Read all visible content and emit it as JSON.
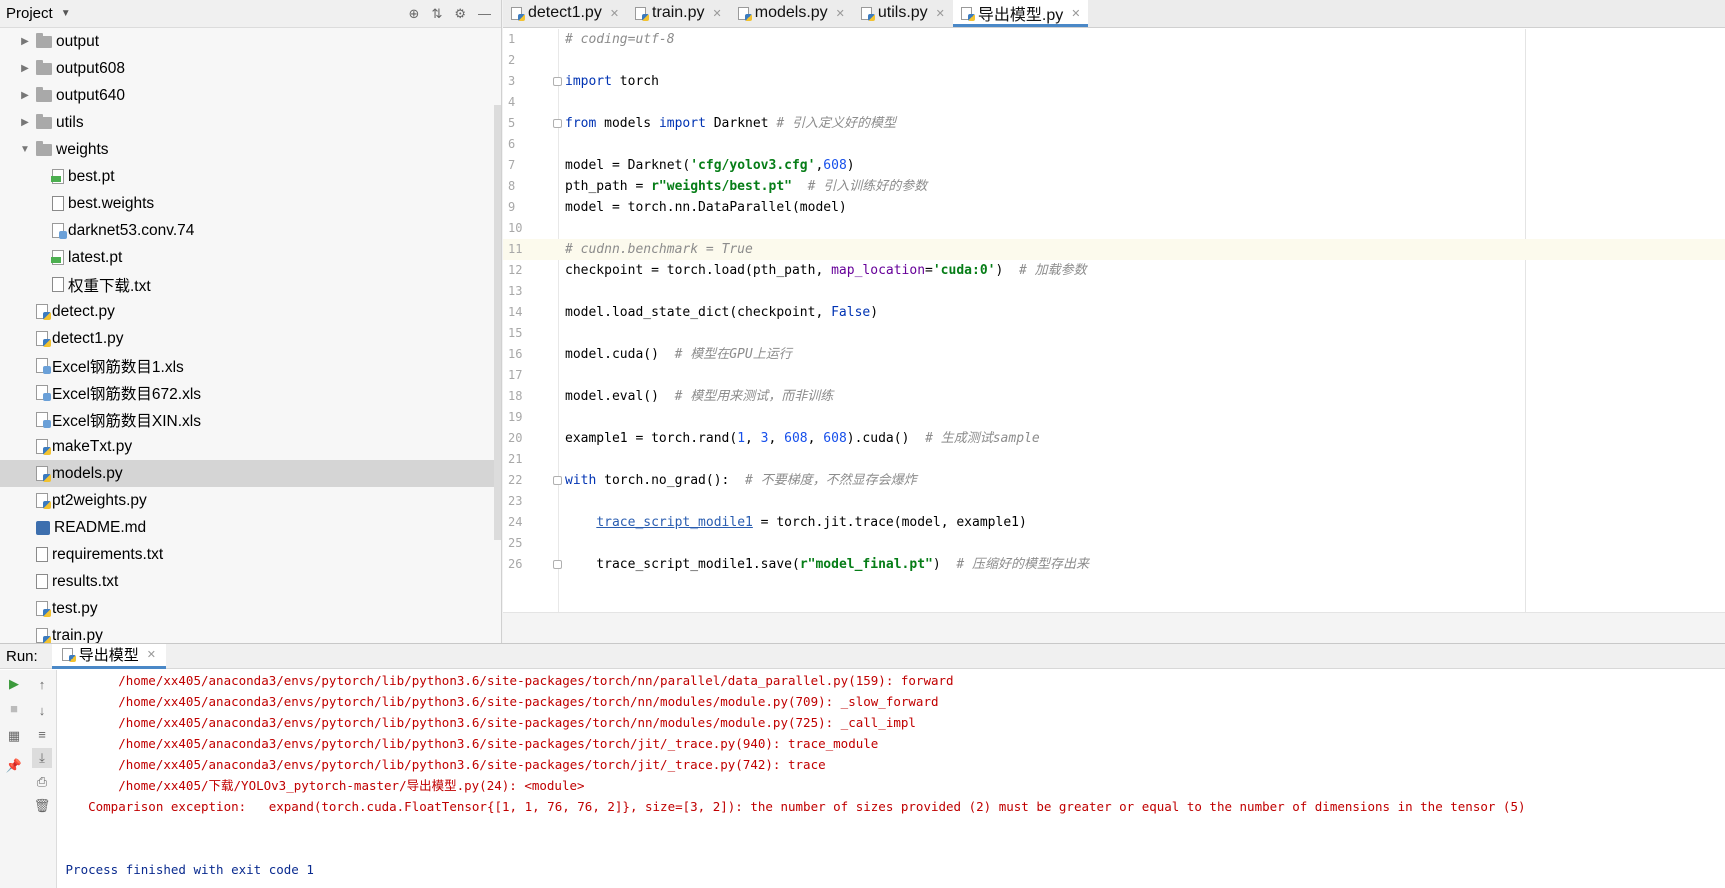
{
  "project": {
    "title": "Project",
    "tree": [
      {
        "label": "output",
        "type": "folder",
        "indent": 0,
        "expanded": false
      },
      {
        "label": "output608",
        "type": "folder",
        "indent": 0,
        "expanded": false
      },
      {
        "label": "output640",
        "type": "folder",
        "indent": 0,
        "expanded": false
      },
      {
        "label": "utils",
        "type": "folder",
        "indent": 0,
        "expanded": false
      },
      {
        "label": "weights",
        "type": "folder",
        "indent": 0,
        "expanded": true
      },
      {
        "label": "best.pt",
        "type": "pt",
        "indent": 1
      },
      {
        "label": "best.weights",
        "type": "file",
        "indent": 1
      },
      {
        "label": "darknet53.conv.74",
        "type": "xls",
        "indent": 1
      },
      {
        "label": "latest.pt",
        "type": "pt",
        "indent": 1
      },
      {
        "label": "权重下载.txt",
        "type": "file",
        "indent": 1
      },
      {
        "label": "detect.py",
        "type": "py",
        "indent": 0
      },
      {
        "label": "detect1.py",
        "type": "py",
        "indent": 0
      },
      {
        "label": "Excel钢筋数目1.xls",
        "type": "xls",
        "indent": 0
      },
      {
        "label": "Excel钢筋数目672.xls",
        "type": "xls",
        "indent": 0
      },
      {
        "label": "Excel钢筋数目XIN.xls",
        "type": "xls",
        "indent": 0
      },
      {
        "label": "makeTxt.py",
        "type": "py",
        "indent": 0
      },
      {
        "label": "models.py",
        "type": "py",
        "indent": 0,
        "selected": true
      },
      {
        "label": "pt2weights.py",
        "type": "py",
        "indent": 0
      },
      {
        "label": "README.md",
        "type": "md",
        "indent": 0
      },
      {
        "label": "requirements.txt",
        "type": "file",
        "indent": 0
      },
      {
        "label": "results.txt",
        "type": "file",
        "indent": 0
      },
      {
        "label": "test.py",
        "type": "py",
        "indent": 0
      },
      {
        "label": "train.py",
        "type": "py",
        "indent": 0
      }
    ]
  },
  "editor": {
    "tabs": [
      {
        "label": "detect1.py",
        "active": false
      },
      {
        "label": "train.py",
        "active": false
      },
      {
        "label": "models.py",
        "active": false
      },
      {
        "label": "utils.py",
        "active": false
      },
      {
        "label": "导出模型.py",
        "active": true
      }
    ],
    "current_line": 11,
    "lines": [
      [
        [
          "cm",
          "# coding=utf-8"
        ]
      ],
      [],
      [
        [
          "kw",
          "import"
        ],
        [
          "",
          " torch"
        ]
      ],
      [],
      [
        [
          "kw",
          "from"
        ],
        [
          "",
          " models "
        ],
        [
          "kw",
          "import"
        ],
        [
          "",
          " Darknet "
        ],
        [
          "cm",
          "# 引入定义好的模型"
        ]
      ],
      [],
      [
        [
          "",
          "model = Darknet("
        ],
        [
          "str",
          "'cfg/yolov3.cfg'"
        ],
        [
          "",
          ","
        ],
        [
          "num",
          "608"
        ],
        [
          "",
          ")"
        ]
      ],
      [
        [
          "",
          "pth_path = "
        ],
        [
          "str",
          "r\"weights/best.pt\""
        ],
        [
          "",
          "  "
        ],
        [
          "cm",
          "# 引入训练好的参数"
        ]
      ],
      [
        [
          "",
          "model = torch.nn.DataParallel(model)"
        ]
      ],
      [],
      [
        [
          "cm",
          "# cudnn.benchmark = True"
        ]
      ],
      [
        [
          "",
          "checkpoint = torch.load(pth_path, "
        ],
        [
          "param",
          "map_location"
        ],
        [
          "",
          "="
        ],
        [
          "str",
          "'cuda:0'"
        ],
        [
          "",
          ")  "
        ],
        [
          "cm",
          "# 加载参数"
        ]
      ],
      [],
      [
        [
          "",
          "model.load_state_dict(checkpoint, "
        ],
        [
          "kw",
          "False"
        ],
        [
          "",
          ")"
        ]
      ],
      [],
      [
        [
          "",
          "model.cuda()  "
        ],
        [
          "cm",
          "# 模型在GPU上运行"
        ]
      ],
      [],
      [
        [
          "",
          "model.eval()  "
        ],
        [
          "cm",
          "# 模型用来测试，而非训练"
        ]
      ],
      [],
      [
        [
          "",
          "example1 = torch.rand("
        ],
        [
          "num",
          "1"
        ],
        [
          "",
          ", "
        ],
        [
          "num",
          "3"
        ],
        [
          "",
          ", "
        ],
        [
          "num",
          "608"
        ],
        [
          "",
          ", "
        ],
        [
          "num",
          "608"
        ],
        [
          "",
          ").cuda()  "
        ],
        [
          "cm",
          "# 生成测试sample"
        ]
      ],
      [],
      [
        [
          "kw",
          "with"
        ],
        [
          "",
          " torch.no_grad():  "
        ],
        [
          "cm",
          "# 不要梯度，不然显存会爆炸"
        ]
      ],
      [],
      [
        [
          "",
          "    "
        ],
        [
          "link",
          "trace_script_modile1"
        ],
        [
          "",
          " = torch.jit.trace(model, example1)"
        ]
      ],
      [],
      [
        [
          "",
          "    trace_script_modile1.save("
        ],
        [
          "str",
          "r\"model_final.pt\""
        ],
        [
          "",
          ")  "
        ],
        [
          "cm",
          "# 压缩好的模型存出来"
        ]
      ]
    ],
    "fold_lines": [
      3,
      5,
      22,
      26
    ]
  },
  "run": {
    "label": "Run:",
    "tab": "导出模型",
    "console": [
      {
        "text": "        /home/xx405/anaconda3/envs/pytorch/lib/python3.6/site-packages/torch/nn/parallel/data_parallel.py(159): forward",
        "color": "red"
      },
      {
        "text": "        /home/xx405/anaconda3/envs/pytorch/lib/python3.6/site-packages/torch/nn/modules/module.py(709): _slow_forward",
        "color": "red"
      },
      {
        "text": "        /home/xx405/anaconda3/envs/pytorch/lib/python3.6/site-packages/torch/nn/modules/module.py(725): _call_impl",
        "color": "red"
      },
      {
        "text": "        /home/xx405/anaconda3/envs/pytorch/lib/python3.6/site-packages/torch/jit/_trace.py(940): trace_module",
        "color": "red"
      },
      {
        "text": "        /home/xx405/anaconda3/envs/pytorch/lib/python3.6/site-packages/torch/jit/_trace.py(742): trace",
        "color": "red"
      },
      {
        "text": "        /home/xx405/下载/YOLOv3_pytorch-master/导出模型.py(24): <module>",
        "color": "red"
      },
      {
        "text": "    Comparison exception:   expand(torch.cuda.FloatTensor{[1, 1, 76, 76, 2]}, size=[3, 2]): the number of sizes provided (2) must be greater or equal to the number of dimensions in the tensor (5)",
        "color": "red"
      },
      {
        "text": "",
        "color": "red"
      },
      {
        "text": "",
        "color": "red"
      },
      {
        "text": " Process finished with exit code 1",
        "color": "blue"
      }
    ]
  },
  "colors": {
    "accent": "#4a88c7",
    "error": "#c00000",
    "selection": "#d5d5d5"
  }
}
